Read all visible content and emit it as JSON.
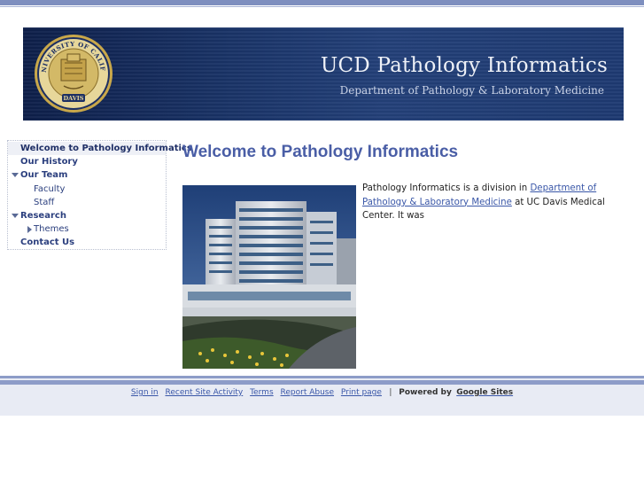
{
  "banner": {
    "title": "UCD Pathology Informatics",
    "subtitle": "Department of Pathology & Laboratory Medicine",
    "seal_text_top": "THE UNIVERSITY OF CALIFORNIA",
    "seal_text_bottom": "DAVIS"
  },
  "sidebar": {
    "items": [
      {
        "label": "Welcome to Pathology Informatics"
      },
      {
        "label": "Our History"
      },
      {
        "label": "Our Team"
      },
      {
        "label": "Faculty"
      },
      {
        "label": "Staff"
      },
      {
        "label": "Research"
      },
      {
        "label": "Themes"
      },
      {
        "label": "Contact Us"
      }
    ]
  },
  "main": {
    "title": "Welcome to Pathology Informatics",
    "intro_prefix": "Pathology Informatics is a division in ",
    "intro_link": "Department of Pathology & Laboratory Medicine",
    "intro_suffix": " at UC Davis Medical Center. It was"
  },
  "footer": {
    "links": [
      "Sign in",
      "Recent Site Activity",
      "Terms",
      "Report Abuse",
      "Print page"
    ],
    "separator": "|",
    "powered_by": "Powered by",
    "powered_link": "Google Sites"
  },
  "colors": {
    "accent": "#4a5ea6",
    "bar": "#7e8fbf",
    "banner": "#1a3468",
    "link": "#3a57a8"
  }
}
